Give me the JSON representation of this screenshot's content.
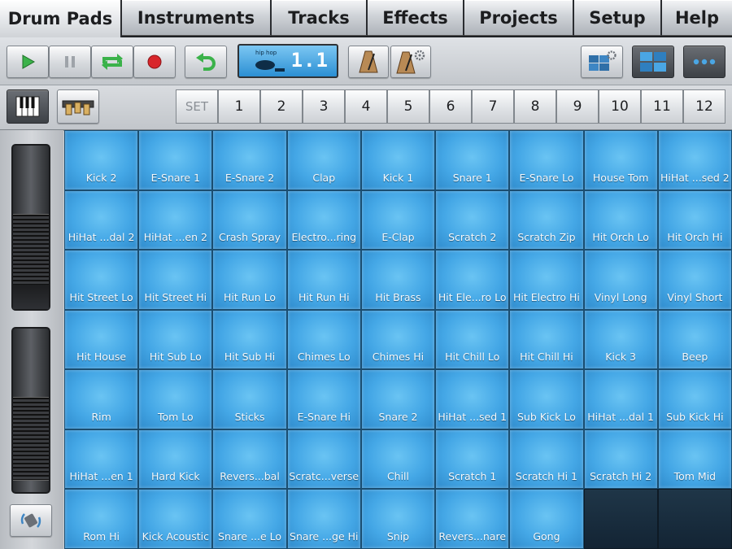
{
  "tabs": [
    {
      "label": "Drum Pads",
      "active": true
    },
    {
      "label": "Instruments"
    },
    {
      "label": "Tracks"
    },
    {
      "label": "Effects"
    },
    {
      "label": "Projects"
    },
    {
      "label": "Setup"
    },
    {
      "label": "Help"
    }
  ],
  "transport": {
    "play_icon": "play-icon",
    "pause_icon": "pause-icon",
    "loop_icon": "loop-icon",
    "record_icon": "record-icon",
    "undo_icon": "undo-icon",
    "lcd_label": "hip hop",
    "lcd_position": "1.1",
    "metronome_icon": "metronome-icon",
    "metronome_settings_icon": "metronome-settings-icon",
    "grid_settings_icon": "grid-settings-icon",
    "pad_view_icon": "pad-grid-icon",
    "more_icon": "more-icon"
  },
  "setrow": {
    "keyboard_icon": "keyboard-icon",
    "mixer_icon": "mixer-icon",
    "set_label": "SET",
    "sets": [
      "1",
      "2",
      "3",
      "4",
      "5",
      "6",
      "7",
      "8",
      "9",
      "10",
      "11",
      "12"
    ]
  },
  "pads": [
    "Kick 2",
    "E-Snare 1",
    "E-Snare 2",
    "Clap",
    "Kick 1",
    "Snare 1",
    "E-Snare Lo",
    "House Tom",
    "HiHat ...sed 2",
    "HiHat ...dal 2",
    "HiHat ...en 2",
    "Crash Spray",
    "Electro...ring",
    "E-Clap",
    "Scratch 2",
    "Scratch Zip",
    "Hit Orch Lo",
    "Hit Orch Hi",
    "Hit Street Lo",
    "Hit Street Hi",
    "Hit Run Lo",
    "Hit Run Hi",
    "Hit Brass",
    "Hit Ele...ro Lo",
    "Hit Electro Hi",
    "Vinyl Long",
    "Vinyl Short",
    "Hit House",
    "Hit Sub Lo",
    "Hit Sub Hi",
    "Chimes Lo",
    "Chimes Hi",
    "Hit Chill Lo",
    "Hit Chill Hi",
    "Kick 3",
    "Beep",
    "Rim",
    "Tom Lo",
    "Sticks",
    "E-Snare Hi",
    "Snare 2",
    "HiHat ...sed 1",
    "Sub Kick Lo",
    "HiHat ...dal 1",
    "Sub Kick Hi",
    "HiHat ...en 1",
    "Hard Kick",
    "Revers...bal",
    "Scratc...verse",
    "Chill",
    "Scratch 1",
    "Scratch Hi 1",
    "Scratch Hi 2",
    "Tom Mid",
    "Rom Hi",
    "Kick Acoustic",
    "Snare ...e Lo",
    "Snare ...ge Hi",
    "Snip",
    "Revers...nare",
    "Gong",
    "",
    ""
  ],
  "colors": {
    "pad": "#44a7e6",
    "pad_empty": "#1b3040",
    "lcd": "#3a9ee0",
    "play": "#3bb24a",
    "record": "#d8262b"
  },
  "left": {
    "rotate_icon": "rotate-icon"
  }
}
